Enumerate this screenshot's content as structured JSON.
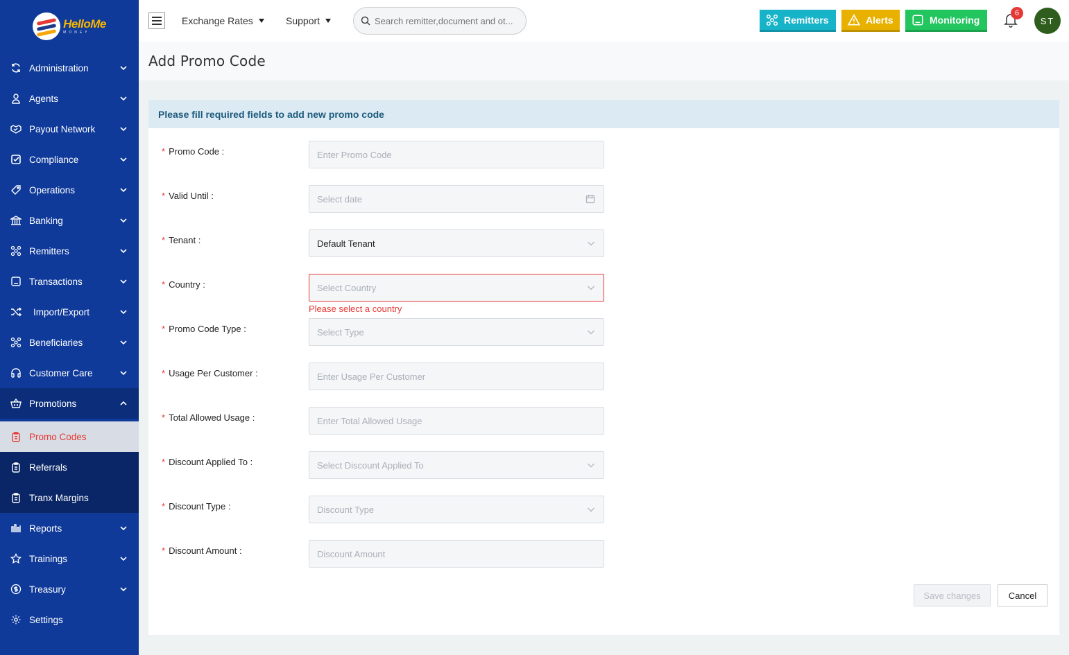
{
  "app": {
    "logo_text": "HelloMe",
    "logo_sub": "MONEY"
  },
  "sidebar": {
    "items": [
      {
        "label": "Administration",
        "icon": "sync-icon"
      },
      {
        "label": "Agents",
        "icon": "user-icon"
      },
      {
        "label": "Payout Network",
        "icon": "handshake-icon"
      },
      {
        "label": "Compliance",
        "icon": "checkbox-icon"
      },
      {
        "label": "Operations",
        "icon": "tag-icon"
      },
      {
        "label": "Banking",
        "icon": "bank-icon"
      },
      {
        "label": "Remitters",
        "icon": "network-icon"
      },
      {
        "label": "Transactions",
        "icon": "receipt-icon"
      },
      {
        "label": "Import/Export",
        "icon": "shuffle-icon"
      },
      {
        "label": "Beneficiaries",
        "icon": "network-icon"
      },
      {
        "label": "Customer Care",
        "icon": "headset-icon"
      },
      {
        "label": "Promotions",
        "icon": "basket-icon"
      }
    ],
    "promotions_sub": [
      {
        "label": "Promo Codes"
      },
      {
        "label": "Referrals"
      },
      {
        "label": "Tranx Margins"
      }
    ],
    "bottom_items": [
      {
        "label": "Reports"
      },
      {
        "label": "Trainings"
      },
      {
        "label": "Treasury"
      },
      {
        "label": "Settings"
      }
    ]
  },
  "header": {
    "exchange_rates": "Exchange Rates",
    "support": "Support",
    "search_placeholder": "Search remitter,document and ot...",
    "remitters": "Remitters",
    "alerts": "Alerts",
    "monitoring": "Monitoring",
    "notification_count": "6",
    "avatar_initials": "ST",
    "colors": {
      "remitters": "#17b3c9",
      "alerts": "#e8b100",
      "monitoring": "#22c55e"
    }
  },
  "page": {
    "title": "Add Promo Code"
  },
  "form": {
    "heading": "Please fill required fields to add new promo code",
    "fields": [
      {
        "label": "Promo Code",
        "placeholder": "Enter Promo Code"
      },
      {
        "label": "Valid Until",
        "placeholder": "Select date"
      },
      {
        "label": "Tenant",
        "value": "Default Tenant"
      },
      {
        "label": "Country",
        "placeholder": "Select Country",
        "error": "Please select a country"
      },
      {
        "label": "Promo Code Type",
        "placeholder": "Select Type"
      },
      {
        "label": "Usage Per Customer",
        "placeholder": "Enter Usage Per Customer"
      },
      {
        "label": "Total Allowed Usage",
        "placeholder": "Enter Total Allowed Usage"
      },
      {
        "label": "Discount Applied To",
        "placeholder": "Select Discount Applied To"
      },
      {
        "label": "Discount Type",
        "placeholder": "Discount Type"
      },
      {
        "label": "Discount Amount",
        "placeholder": "Discount Amount"
      }
    ],
    "save_label": "Save changes",
    "cancel_label": "Cancel"
  }
}
